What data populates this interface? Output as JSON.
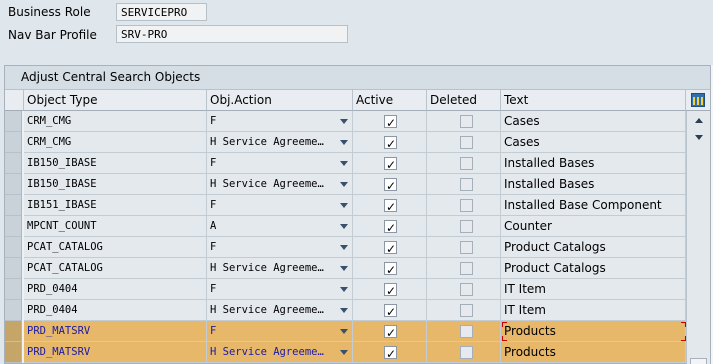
{
  "header": {
    "business_role_label": "Business Role",
    "business_role_value": "SERVICEPRO",
    "navbar_profile_label": "Nav Bar Profile",
    "navbar_profile_value": "SRV-PRO"
  },
  "panel": {
    "title": "Adjust Central Search Objects"
  },
  "table": {
    "columns": [
      "Object Type",
      "Obj.Action",
      "Active",
      "Deleted",
      "Text"
    ],
    "rows": [
      {
        "object_type": "CRM_CMG",
        "obj_action": "F",
        "active": true,
        "deleted": false,
        "text": "Cases"
      },
      {
        "object_type": "CRM_CMG",
        "obj_action": "H Service Agreeme…",
        "active": true,
        "deleted": false,
        "text": "Cases"
      },
      {
        "object_type": "IB150_IBASE",
        "obj_action": "F",
        "active": true,
        "deleted": false,
        "text": "Installed Bases"
      },
      {
        "object_type": "IB150_IBASE",
        "obj_action": "H Service Agreeme…",
        "active": true,
        "deleted": false,
        "text": "Installed Bases"
      },
      {
        "object_type": "IB151_IBASE",
        "obj_action": "F",
        "active": true,
        "deleted": false,
        "text": "Installed Base Component"
      },
      {
        "object_type": "MPCNT_COUNT",
        "obj_action": "A",
        "active": true,
        "deleted": false,
        "text": "Counter"
      },
      {
        "object_type": "PCAT_CATALOG",
        "obj_action": "F",
        "active": true,
        "deleted": false,
        "text": "Product Catalogs"
      },
      {
        "object_type": "PCAT_CATALOG",
        "obj_action": "H Service Agreeme…",
        "active": true,
        "deleted": false,
        "text": "Product Catalogs"
      },
      {
        "object_type": "PRD_0404",
        "obj_action": "F",
        "active": true,
        "deleted": false,
        "text": "IT Item"
      },
      {
        "object_type": "PRD_0404",
        "obj_action": "H Service Agreeme…",
        "active": true,
        "deleted": false,
        "text": "IT Item"
      },
      {
        "object_type": "PRD_MATSRV",
        "obj_action": "F",
        "active": true,
        "deleted": false,
        "text": "Products",
        "highlighted": true
      },
      {
        "object_type": "PRD_MATSRV",
        "obj_action": "H Service Agreeme…",
        "active": true,
        "deleted": false,
        "text": "Products",
        "highlighted": true
      }
    ]
  },
  "icons": {
    "table_settings": "table-settings-icon",
    "dropdown": "chevron-down-icon",
    "scroll_up": "arrow-up-icon",
    "scroll_down": "arrow-down-icon"
  },
  "colors": {
    "highlight_row": "#e7b86a",
    "panel_bg": "#eef1f4"
  }
}
